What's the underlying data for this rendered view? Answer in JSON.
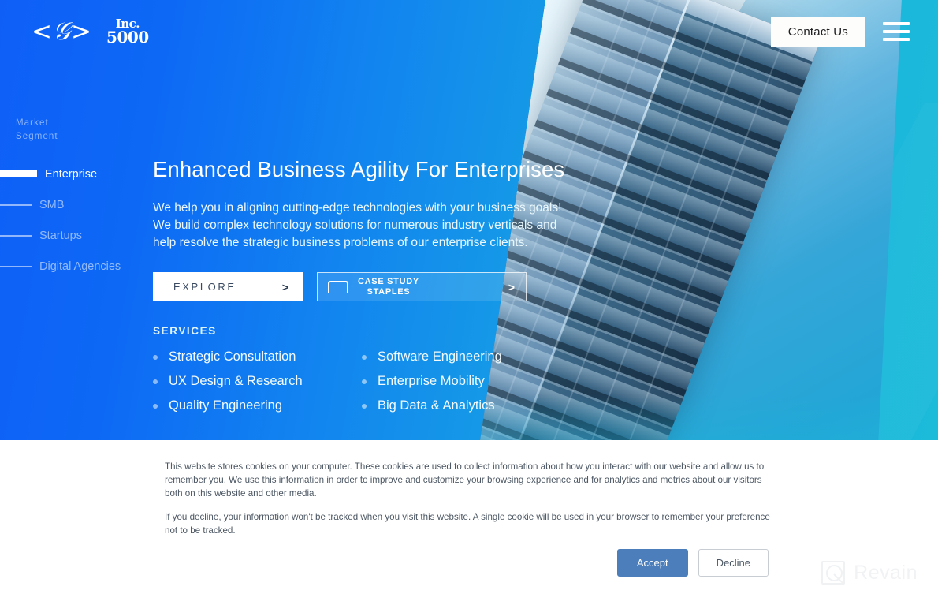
{
  "header": {
    "logo_text": "<𝒢>",
    "badge_top": "Inc.",
    "badge_bottom": "5000",
    "contact_label": "Contact Us",
    "menu_icon": "hamburger-menu-icon"
  },
  "sidebar": {
    "label": "Market Segment",
    "items": [
      {
        "label": "Enterprise",
        "active": true
      },
      {
        "label": "SMB",
        "active": false
      },
      {
        "label": "Startups",
        "active": false
      },
      {
        "label": "Digital Agencies",
        "active": false
      }
    ]
  },
  "hero": {
    "headline": "Enhanced Business Agility For Enterprises",
    "subcopy": "We help you in aligning cutting-edge technologies with your business goals! We build complex technology solutions for numerous industry verticals and help resolve the strategic business problems of our enterprise clients.",
    "explore_label": "EXPLORE",
    "explore_chevron": ">",
    "case_line1": "CASE STUDY",
    "case_line2": "STAPLES",
    "case_chevron": ">",
    "case_icon": "staple-bracket-icon"
  },
  "services": {
    "title": "SERVICES",
    "items": [
      "Strategic Consultation",
      "Software Engineering",
      "UX Design & Research",
      "Enterprise Mobility",
      "Quality Engineering",
      "Big Data & Analytics"
    ]
  },
  "cookie": {
    "paragraph1": "This website stores cookies on your computer. These cookies are used to collect information about how you interact with our website and allow us to remember you. We use this information in order to improve and customize your browsing experience and for analytics and metrics about our visitors both on this website and other media.",
    "paragraph2": "If you decline, your information won't be tracked when you visit this website. A single cookie will be used in your browser to remember your preference not to be tracked.",
    "accept_label": "Accept",
    "decline_label": "Decline"
  },
  "watermark": {
    "text": "Revain",
    "icon": "revain-logo-icon"
  },
  "colors": {
    "gradient_start": "#0d68f5",
    "gradient_end": "#1cbcd9",
    "accept_blue": "#4b7ebb",
    "contact_bg": "#fdfdfb",
    "cookie_bg": "#ffffff"
  }
}
